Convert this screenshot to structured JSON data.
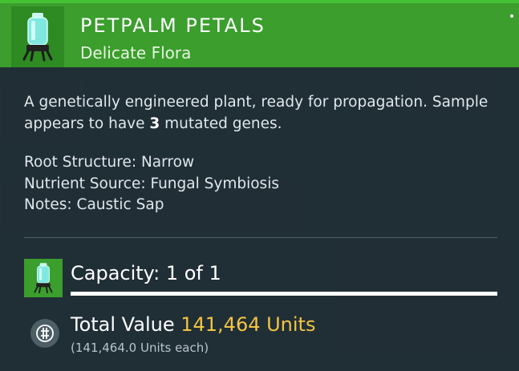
{
  "item": {
    "name": "PETPALM PETALS",
    "category": "Delicate Flora",
    "icon": "bio-container-icon",
    "description_prefix": "A genetically engineered plant, ready for propagation. Sample appears to have ",
    "mutated_gene_count": "3",
    "description_suffix": " mutated genes.",
    "properties": [
      "Root Structure: Narrow",
      "Nutrient Source: Fungal Symbiosis",
      "Notes: Caustic Sap"
    ]
  },
  "capacity": {
    "label": "Capacity: 1 of 1",
    "fill_fraction": 1.0
  },
  "value": {
    "label": "Total Value",
    "amount": "141,464 Units",
    "each": "(141,464.0 Units each)",
    "icon": "units-currency-icon"
  },
  "colors": {
    "header_green": "#3b9e2d",
    "accent_gold": "#f2c542",
    "panel_bg": "#24333a"
  }
}
